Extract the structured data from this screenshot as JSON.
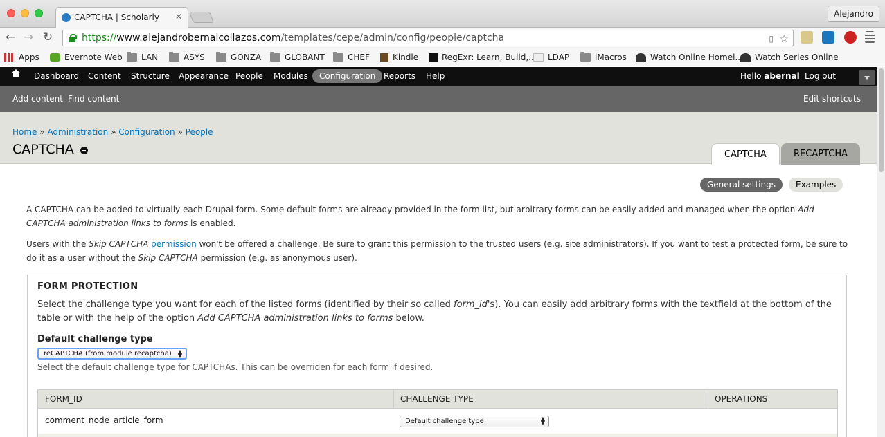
{
  "browser": {
    "tab_title": "CAPTCHA | Scholarly",
    "profile": "Alejandro",
    "url_scheme": "https://",
    "url_host": "www.alejandrobernalcollazos.com",
    "url_path": "/templates/cepe/admin/config/people/captcha",
    "bookmarks": [
      {
        "label": "Apps"
      },
      {
        "label": "Evernote Web"
      },
      {
        "label": "LAN"
      },
      {
        "label": "ASYS"
      },
      {
        "label": "GONZA"
      },
      {
        "label": "GLOBANT"
      },
      {
        "label": "CHEF"
      },
      {
        "label": "Kindle"
      },
      {
        "label": "RegExr: Learn, Build,..."
      },
      {
        "label": "LDAP"
      },
      {
        "label": "iMacros"
      },
      {
        "label": "Watch Online Homel..."
      },
      {
        "label": "Watch Series Online"
      }
    ]
  },
  "admin_toolbar": {
    "items": [
      "Dashboard",
      "Content",
      "Structure",
      "Appearance",
      "People",
      "Modules",
      "Configuration",
      "Reports",
      "Help"
    ],
    "active": "Configuration",
    "hello": "Hello",
    "username": "abernal",
    "logout": "Log out"
  },
  "shortcuts": {
    "items": [
      "Add content",
      "Find content"
    ],
    "edit": "Edit shortcuts"
  },
  "header": {
    "breadcrumb": [
      "Home",
      "Administration",
      "Configuration",
      "People"
    ],
    "separator": "»",
    "title": "CAPTCHA",
    "tabs": [
      "CAPTCHA",
      "RECAPTCHA"
    ]
  },
  "secondary_tabs": [
    "General settings",
    "Examples"
  ],
  "intro": {
    "p1_a": "A CAPTCHA can be added to virtually each Drupal form. Some default forms are already provided in the form list, but arbitrary forms can be easily added and managed when the option ",
    "p1_em": "Add CAPTCHA administration links to forms",
    "p1_b": " is enabled.",
    "p2_a": "Users with the ",
    "p2_em1": "Skip CAPTCHA",
    "p2_link": "permission",
    "p2_b": " won't be offered a challenge. Be sure to grant this permission to the trusted users (e.g. site administrators). If you want to test a protected form, be sure to do it as a user without the ",
    "p2_em2": "Skip CAPTCHA",
    "p2_c": " permission (e.g. as anonymous user)."
  },
  "form_protection": {
    "legend": "FORM PROTECTION",
    "desc_a": "Select the challenge type you want for each of the listed forms (identified by their so called ",
    "desc_em1": "form_id",
    "desc_b": "'s). You can easily add arbitrary forms with the textfield at the bottom of the table or with the help of the option ",
    "desc_em2": "Add CAPTCHA administration links to forms",
    "desc_c": " below.",
    "default_label": "Default challenge type",
    "default_value": "reCAPTCHA (from module recaptcha)",
    "default_help": "Select the default challenge type for CAPTCHAs. This can be overriden for each form if desired.",
    "table": {
      "headers": [
        "FORM_ID",
        "CHALLENGE TYPE",
        "OPERATIONS"
      ],
      "rows": [
        {
          "form_id": "comment_node_article_form",
          "challenge": "Default challenge type"
        }
      ]
    }
  }
}
